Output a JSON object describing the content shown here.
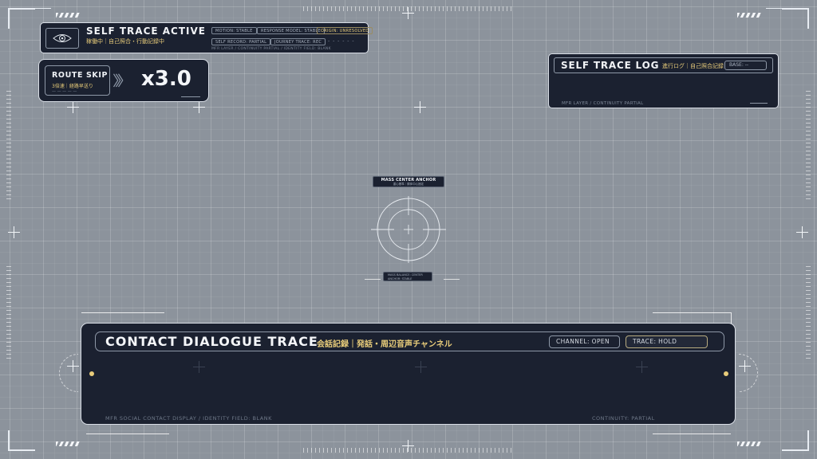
{
  "self_trace": {
    "title": "SELF TRACE ACTIVE",
    "subtitle": "稼働中｜自己照合・行動記録中",
    "tags": [
      "MOTION: STABLE",
      "RESPONSE MODEL: STABLE",
      "ORIGIN: UNRESOLVED",
      "SELF RECORD: PARTIAL",
      "JOURNEY TRACE: REC"
    ],
    "dashes": "- - - - - -",
    "footer": "MFR LAYER / CONTINUITY PARTIAL / IDENTITY FIELD: BLANK"
  },
  "route_skip": {
    "title": "ROUTE SKIP",
    "subtitle": "3倍速｜経路早送り",
    "dashes": "— — — — —",
    "chevrons": "〉〉〉",
    "multiplier": "x3.0"
  },
  "log": {
    "title": "SELF TRACE LOG",
    "subtitle": "進行ログ｜自己照合記録",
    "base": "BASE: --",
    "footer": "MFR LAYER / CONTINUITY PARTIAL"
  },
  "anchor": {
    "title": "MASS CENTER ANCHOR",
    "subtitle": "重心基準｜胴体中心固定",
    "lower_line1": "MASS BALANCE: CENTER",
    "lower_line2": "ANCHOR: STABLE"
  },
  "dialogue": {
    "title": "CONTACT DIALOGUE TRACE",
    "subtitle": "会話記録｜発話・周辺音声チャンネル",
    "channel": "CHANNEL: OPEN",
    "trace": "TRACE: HOLD",
    "footer_left": "MFR SOCIAL CONTACT DISPLAY / IDENTITY FIELD: BLANK",
    "footer_right": "CONTINUITY: PARTIAL"
  },
  "colors": {
    "panel": "#1b2130",
    "accent": "#e8cc7a",
    "background": "#8c939c"
  }
}
